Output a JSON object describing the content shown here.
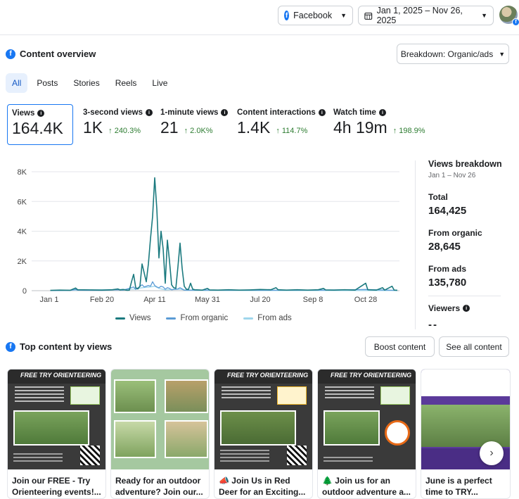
{
  "topbar": {
    "platform_label": "Facebook",
    "date_range": "Jan 1, 2025 – Nov 26, 2025"
  },
  "overview": {
    "title": "Content overview",
    "breakdown_label": "Breakdown: Organic/ads",
    "tabs": [
      {
        "label": "All",
        "active": true
      },
      {
        "label": "Posts",
        "active": false
      },
      {
        "label": "Stories",
        "active": false
      },
      {
        "label": "Reels",
        "active": false
      },
      {
        "label": "Live",
        "active": false
      }
    ],
    "metrics": [
      {
        "label": "Views",
        "value": "164.4K",
        "change": ""
      },
      {
        "label": "3-second views",
        "value": "1K",
        "change": "↑ 240.3%"
      },
      {
        "label": "1-minute views",
        "value": "21",
        "change": "↑ 2.0K%"
      },
      {
        "label": "Content interactions",
        "value": "1.4K",
        "change": "↑ 114.7%"
      },
      {
        "label": "Watch time",
        "value": "4h 19m",
        "change": "↑ 198.9%"
      }
    ]
  },
  "chart_data": {
    "type": "line",
    "x_ticks": [
      "Jan 1",
      "Feb 20",
      "Apr 11",
      "May 31",
      "Jul 20",
      "Sep 8",
      "Oct 28"
    ],
    "y_ticks": [
      "0",
      "2K",
      "4K",
      "6K",
      "8K"
    ],
    "ylim": [
      0,
      8000
    ],
    "grid": true,
    "legend_position": "bottom",
    "series": [
      {
        "name": "Views",
        "color": "#1b7a7f",
        "points": [
          [
            1,
            20
          ],
          [
            10,
            40
          ],
          [
            20,
            30
          ],
          [
            25,
            180
          ],
          [
            27,
            60
          ],
          [
            40,
            50
          ],
          [
            50,
            40
          ],
          [
            60,
            60
          ],
          [
            65,
            120
          ],
          [
            67,
            50
          ],
          [
            70,
            80
          ],
          [
            72,
            50
          ],
          [
            74,
            30
          ],
          [
            76,
            40
          ],
          [
            78,
            600
          ],
          [
            80,
            1100
          ],
          [
            82,
            200
          ],
          [
            84,
            120
          ],
          [
            86,
            300
          ],
          [
            88,
            1800
          ],
          [
            90,
            1200
          ],
          [
            92,
            600
          ],
          [
            94,
            1800
          ],
          [
            96,
            3500
          ],
          [
            98,
            5000
          ],
          [
            100,
            7600
          ],
          [
            102,
            5500
          ],
          [
            104,
            2200
          ],
          [
            106,
            4000
          ],
          [
            108,
            2800
          ],
          [
            110,
            500
          ],
          [
            112,
            3400
          ],
          [
            114,
            2000
          ],
          [
            116,
            400
          ],
          [
            118,
            200
          ],
          [
            120,
            150
          ],
          [
            122,
            1600
          ],
          [
            124,
            3200
          ],
          [
            126,
            1500
          ],
          [
            128,
            300
          ],
          [
            130,
            100
          ],
          [
            132,
            80
          ],
          [
            134,
            500
          ],
          [
            136,
            100
          ],
          [
            138,
            60
          ],
          [
            145,
            40
          ],
          [
            150,
            150
          ],
          [
            152,
            50
          ],
          [
            160,
            40
          ],
          [
            170,
            60
          ],
          [
            180,
            40
          ],
          [
            190,
            50
          ],
          [
            200,
            80
          ],
          [
            210,
            60
          ],
          [
            215,
            200
          ],
          [
            217,
            60
          ],
          [
            225,
            40
          ],
          [
            235,
            60
          ],
          [
            245,
            40
          ],
          [
            255,
            60
          ],
          [
            260,
            150
          ],
          [
            262,
            50
          ],
          [
            270,
            40
          ],
          [
            280,
            60
          ],
          [
            290,
            40
          ],
          [
            300,
            500
          ],
          [
            302,
            60
          ],
          [
            310,
            40
          ],
          [
            316,
            200
          ],
          [
            318,
            40
          ],
          [
            325,
            300
          ],
          [
            327,
            40
          ],
          [
            330,
            30
          ]
        ]
      },
      {
        "name": "From organic",
        "color": "#5b9bd5",
        "points": [
          [
            1,
            10
          ],
          [
            20,
            20
          ],
          [
            25,
            80
          ],
          [
            27,
            30
          ],
          [
            50,
            20
          ],
          [
            65,
            60
          ],
          [
            70,
            30
          ],
          [
            80,
            250
          ],
          [
            82,
            80
          ],
          [
            88,
            400
          ],
          [
            90,
            250
          ],
          [
            94,
            350
          ],
          [
            96,
            300
          ],
          [
            98,
            600
          ],
          [
            100,
            350
          ],
          [
            102,
            250
          ],
          [
            104,
            200
          ],
          [
            106,
            300
          ],
          [
            108,
            250
          ],
          [
            110,
            100
          ],
          [
            112,
            200
          ],
          [
            114,
            150
          ],
          [
            116,
            60
          ],
          [
            122,
            120
          ],
          [
            124,
            200
          ],
          [
            126,
            120
          ],
          [
            128,
            40
          ],
          [
            150,
            40
          ],
          [
            200,
            30
          ],
          [
            260,
            40
          ],
          [
            300,
            80
          ],
          [
            330,
            20
          ]
        ]
      },
      {
        "name": "From ads",
        "color": "#9fd6ec",
        "points": [
          [
            1,
            5
          ],
          [
            80,
            100
          ],
          [
            88,
            200
          ],
          [
            96,
            250
          ],
          [
            100,
            300
          ],
          [
            104,
            150
          ],
          [
            110,
            50
          ],
          [
            124,
            100
          ],
          [
            130,
            20
          ],
          [
            200,
            10
          ],
          [
            330,
            10
          ]
        ]
      }
    ]
  },
  "views_breakdown": {
    "title": "Views breakdown",
    "subtitle": "Jan 1 – Nov 26",
    "items": [
      {
        "label": "Total",
        "value": "164,425"
      },
      {
        "label": "From organic",
        "value": "28,645"
      },
      {
        "label": "From ads",
        "value": "135,780"
      }
    ],
    "viewers_label": "Viewers",
    "viewers_value": "--"
  },
  "top_content": {
    "title": "Top content by views",
    "boost_label": "Boost content",
    "see_all_label": "See all content",
    "poster_title": "FREE TRY ORIENTEERING",
    "cards": [
      {
        "caption": "Join our FREE - Try Orienteering events!...",
        "style": "dark",
        "emoji": ""
      },
      {
        "caption": "Ready for an outdoor adventure? Join our...",
        "style": "collage",
        "emoji": ""
      },
      {
        "caption": "Join Us in Red Deer for an Exciting...",
        "style": "dark",
        "emoji": "📣"
      },
      {
        "caption": "Join us for an outdoor adventure a...",
        "style": "dark",
        "emoji": "🌲"
      },
      {
        "caption": "June is a perfect time to TRY...",
        "style": "purple",
        "emoji": ""
      }
    ]
  }
}
